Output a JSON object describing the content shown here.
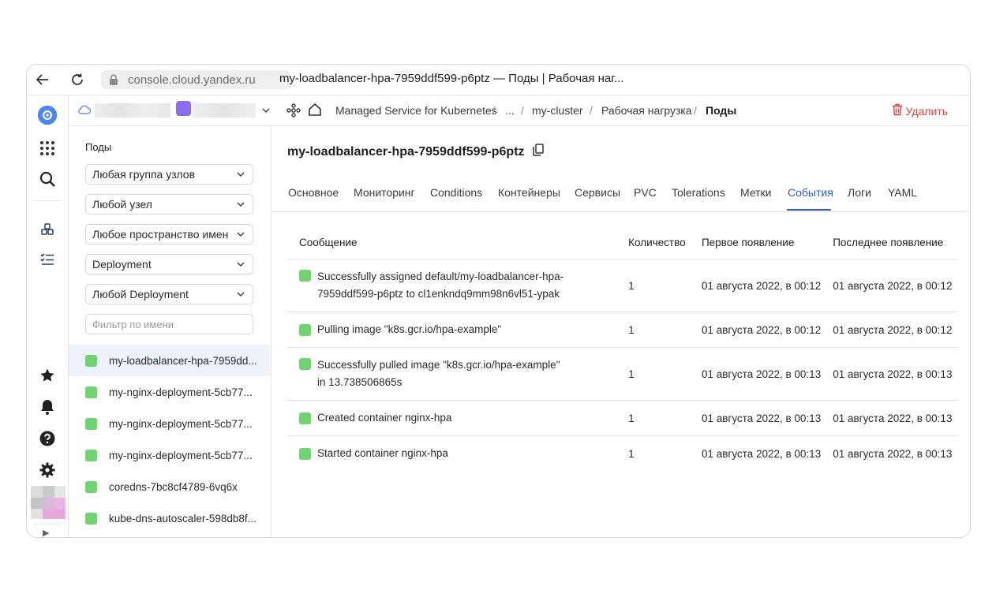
{
  "browser": {
    "url": "console.cloud.yandex.ru",
    "page_title": "my-loadbalancer-hpa-7959ddf599-p6ptz — Поды | Рабочая наг..."
  },
  "header": {
    "breadcrumbs": [
      "Managed Service for Kubernetes",
      "...",
      "my-cluster",
      "Рабочая нагрузка",
      "Поды"
    ],
    "separator": "/",
    "delete_label": "Удалить"
  },
  "sidebar": {
    "title": "Поды",
    "filters": [
      "Любая группа узлов",
      "Любой узел",
      "Любое пространство имен",
      "Deployment",
      "Любой Deployment"
    ],
    "search_placeholder": "Фильтр по имени",
    "pods": [
      "my-loadbalancer-hpa-7959dd...",
      "my-nginx-deployment-5cb77...",
      "my-nginx-deployment-5cb77...",
      "my-nginx-deployment-5cb77...",
      "coredns-7bc8cf4789-6vq6x",
      "kube-dns-autoscaler-598db8f..."
    ]
  },
  "main": {
    "title": "my-loadbalancer-hpa-7959ddf599-p6ptz",
    "tabs": [
      "Основное",
      "Мониторинг",
      "Conditions",
      "Контейнеры",
      "Сервисы",
      "PVC",
      "Tolerations",
      "Метки",
      "События",
      "Логи",
      "YAML"
    ],
    "active_tab": "События",
    "table": {
      "headers": [
        "Сообщение",
        "Количество",
        "Первое появление",
        "Последнее появление"
      ],
      "rows": [
        {
          "message": "Successfully assigned default/my-loadbalancer-hpa-7959ddf599-p6ptz to cl1enkndq9mm98n6vl51-ypak",
          "count": "1",
          "first": "01 августа 2022, в 00:12",
          "last": "01 августа 2022, в 00:12"
        },
        {
          "message": "Pulling image \"k8s.gcr.io/hpa-example\"",
          "count": "1",
          "first": "01 августа 2022, в 00:12",
          "last": "01 августа 2022, в 00:12"
        },
        {
          "message": "Successfully pulled image \"k8s.gcr.io/hpa-example\" in 13.738506865s",
          "count": "1",
          "first": "01 августа 2022, в 00:13",
          "last": "01 августа 2022, в 00:13"
        },
        {
          "message": "Created container nginx-hpa",
          "count": "1",
          "first": "01 августа 2022, в 00:13",
          "last": "01 августа 2022, в 00:13"
        },
        {
          "message": "Started container nginx-hpa",
          "count": "1",
          "first": "01 августа 2022, в 00:13",
          "last": "01 августа 2022, в 00:13"
        }
      ]
    }
  },
  "colors": {
    "accent": "#2d5bd6",
    "status_ok": "#6fd36f",
    "danger": "#e23b3b",
    "brand_icon": "#4a86f0"
  }
}
